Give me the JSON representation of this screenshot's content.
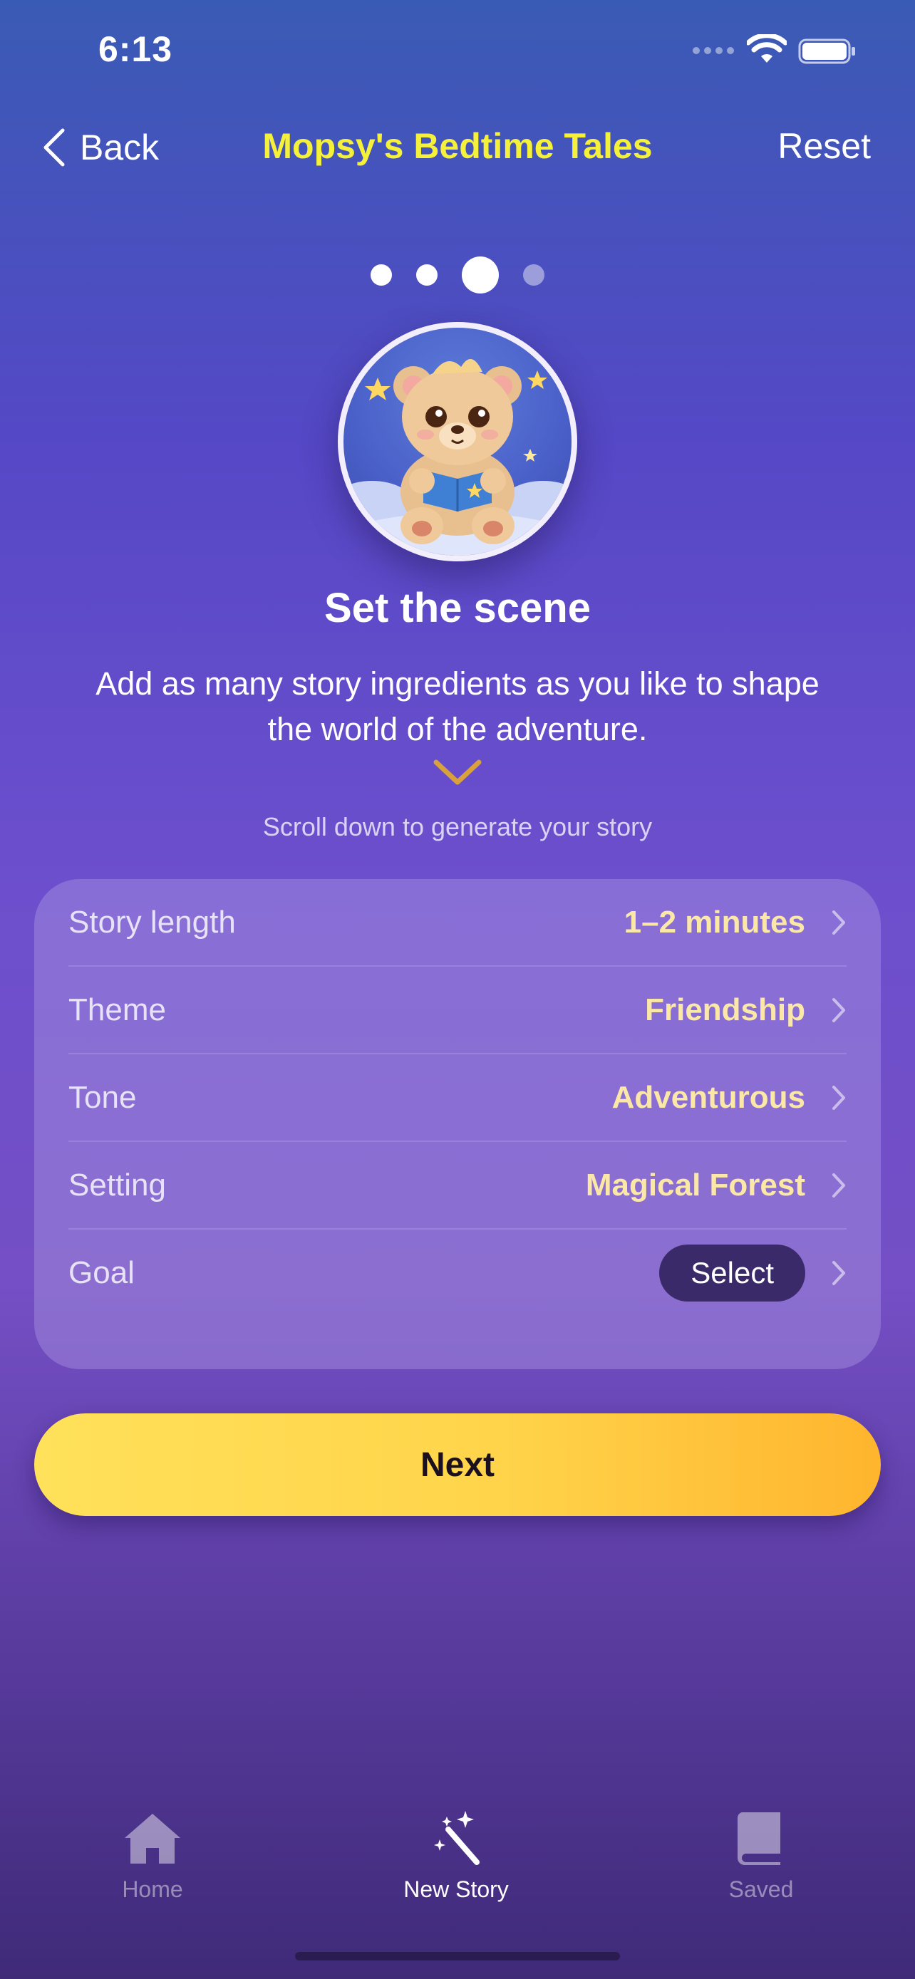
{
  "status_bar": {
    "time": "6:13"
  },
  "nav": {
    "back_label": "Back",
    "title": "Mopsy's Bedtime Tales",
    "reset_label": "Reset"
  },
  "pager": {
    "total": 4,
    "active_index": 2
  },
  "intro": {
    "title": "Set the scene",
    "description": "Add as many story ingredients as you like to shape the world of the adventure.",
    "scroll_hint": "Scroll down to generate your story"
  },
  "options": [
    {
      "label": "Story length",
      "value": "1–2 minutes"
    },
    {
      "label": "Theme",
      "value": "Friendship"
    },
    {
      "label": "Tone",
      "value": "Adventurous"
    },
    {
      "label": "Setting",
      "value": "Magical Forest"
    },
    {
      "label": "Goal",
      "value": "Select"
    }
  ],
  "next_label": "Next",
  "tabs": [
    {
      "label": "Home",
      "icon": "house-icon",
      "active": false
    },
    {
      "label": "New Story",
      "icon": "magic-wand-icon",
      "active": true
    },
    {
      "label": "Saved",
      "icon": "book-icon",
      "active": false
    }
  ],
  "colors": {
    "title_yellow": "#f5f03a",
    "value_cream": "#fbe7a6",
    "button_yellow": "#ffd44a",
    "pill_dark": "#3a2a6a"
  }
}
